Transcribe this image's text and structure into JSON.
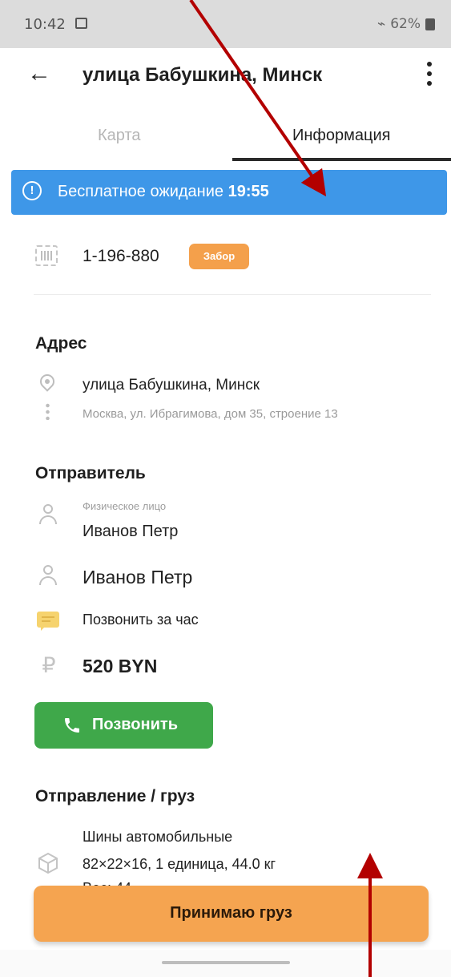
{
  "status_bar": {
    "time": "10:42",
    "right_text": "62%"
  },
  "app_bar": {
    "title": "улица Бабушкина, Минск",
    "back_icon": "arrow-left-icon",
    "more_icon": "more-vertical-icon"
  },
  "tabs": [
    {
      "label": "Карта",
      "active": false
    },
    {
      "label": "Информация",
      "active": true
    }
  ],
  "banner": {
    "text": "Бесплатное ожидание",
    "time": "19:55",
    "color": "#3e97e8"
  },
  "order": {
    "number": "1-196-880",
    "badge": "Забор",
    "badge_color": "#f4a04b"
  },
  "address": {
    "title": "Адрес",
    "main": "улица Бабушкина, Минск",
    "sub": "Москва, ул. Ибрагимова, дом 35, строение 13"
  },
  "sender": {
    "title": "Отправитель",
    "type": "Физическое лицо",
    "name": "Иванов Петр",
    "contact": "Иванов Петр",
    "comment": "Позвонить за час",
    "price": "520 BYN",
    "call_button": "Позвонить",
    "call_color": "#3fa84a"
  },
  "cargo": {
    "title": "Отправление / груз",
    "name": "Шины автомобильные",
    "dims": "82×22×16, 1 единица, 44.0 кг",
    "partial": "Вес: 44"
  },
  "accept_button": {
    "label": "Принимаю груз",
    "color": "#f5a450"
  },
  "annotation_color": "#b30000"
}
